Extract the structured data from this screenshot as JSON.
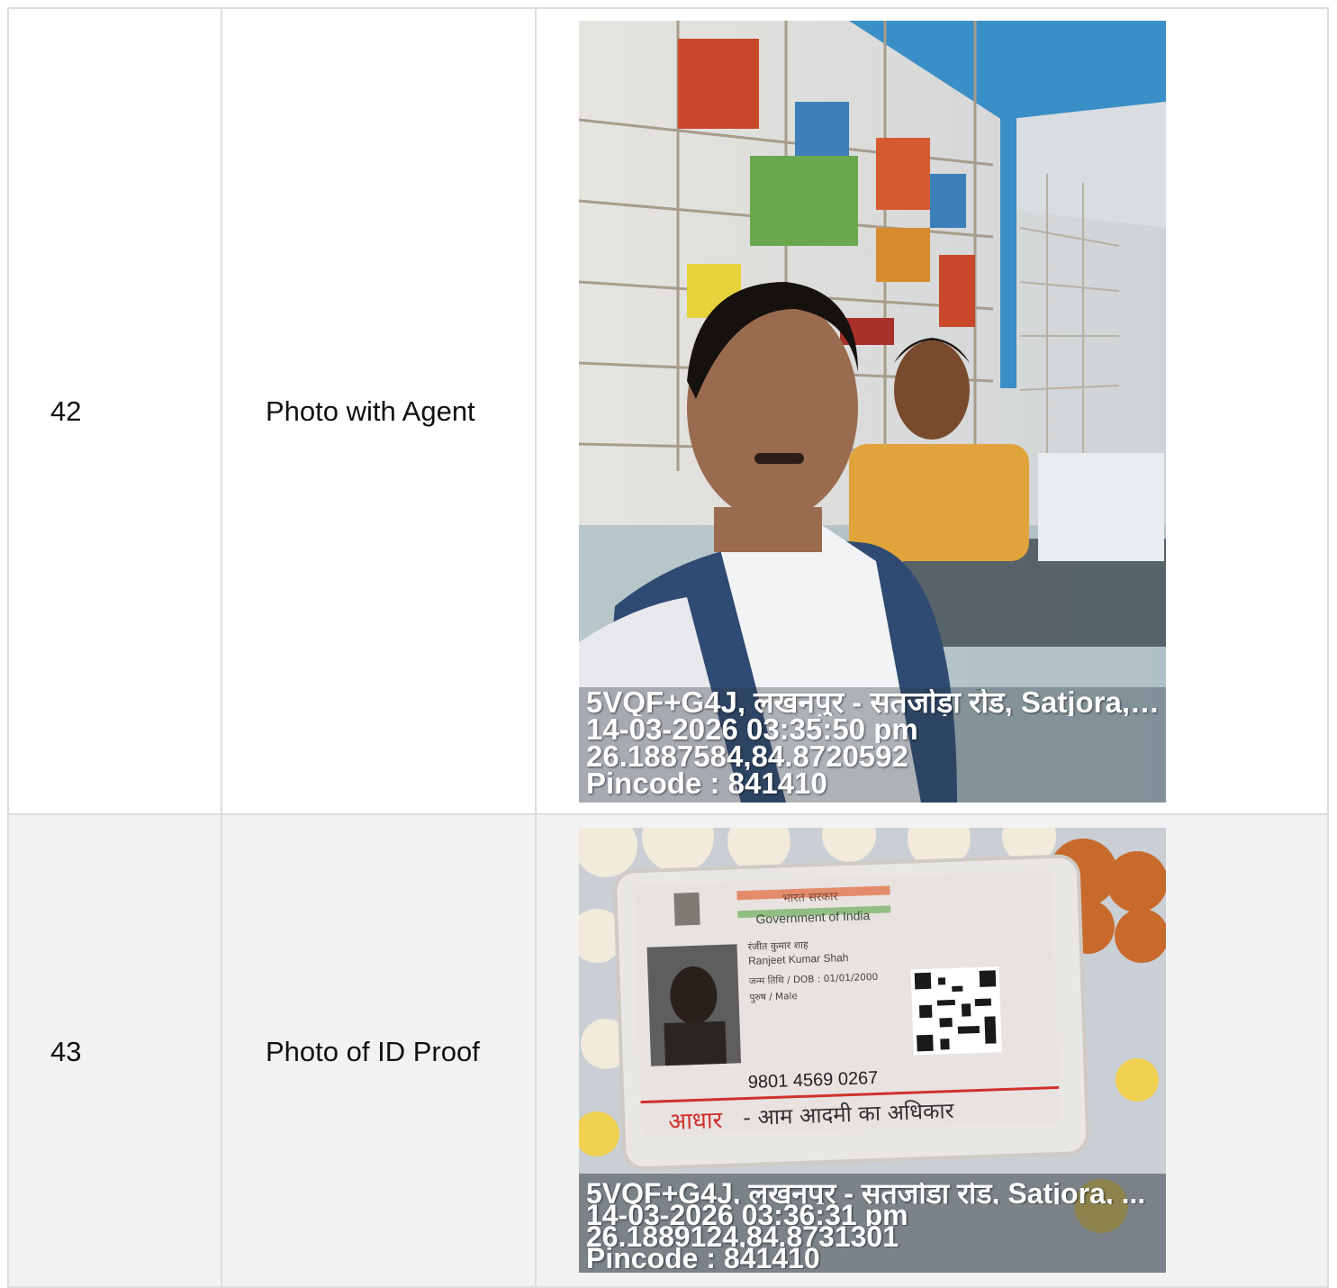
{
  "rows": [
    {
      "number": "42",
      "label": "Photo with Agent",
      "photo": {
        "description_icon": "selfie-photo",
        "overlay_lines": [
          "5VQF+G4J, लखनपुर - सतजोड़ा रोड, Satjora, ...",
          "14-03-2026 03:35:50 pm",
          "26.1887584,84.8720592",
          "Pincode : 841410"
        ]
      }
    },
    {
      "number": "43",
      "label": "Photo of ID Proof",
      "photo": {
        "description_icon": "id-card-photo",
        "id_card": {
          "header_hindi": "भारत सरकार",
          "header_english": "Government of India",
          "name_hindi": "रंजीत कुमार शाह",
          "name_english": "Ranjeet Kumar Shah",
          "dob": "जन्म तिथि / DOB : 01/01/2000",
          "gender": "पुरुष / Male",
          "number": "9801 4569 0267",
          "footer_brand": "आधार",
          "footer_tagline": "- आम आदमी का अधिकार"
        },
        "overlay_lines": [
          "5VQF+G4J, लखनपुर - सतजोड़ा रोड, Satjora, ...",
          "14-03-2026 03:36:31 pm",
          "26.1889124,84.8731301",
          "Pincode : 841410"
        ]
      }
    }
  ],
  "colors": {
    "border": "#dddddd",
    "row_alt": "#f2f2f2",
    "text": "#111111",
    "aadhaar_red": "#d0312d"
  }
}
